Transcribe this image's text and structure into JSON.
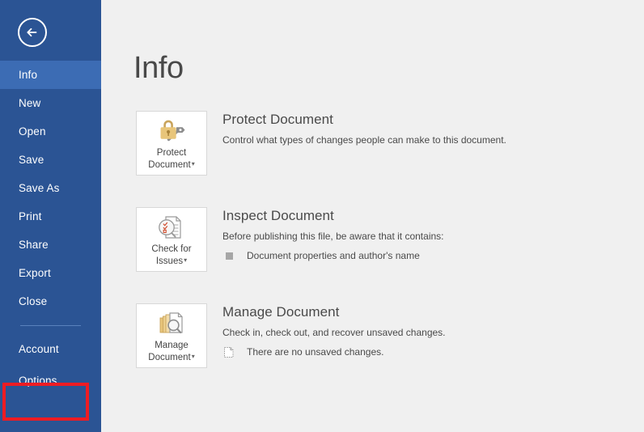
{
  "colors": {
    "sidebar_bg": "#2b5494",
    "sidebar_selected": "#3c6cb4",
    "main_bg": "#f0f0f0",
    "highlight_red": "#ee1c23",
    "text_gray": "#4a4a4a",
    "lock_gold": "#e8c57a",
    "key_gray": "#8c8c8c"
  },
  "sidebar": {
    "back_button": {
      "icon": "back-arrow-icon",
      "label": "Back"
    },
    "items": [
      {
        "label": "Info",
        "selected": true
      },
      {
        "label": "New",
        "selected": false
      },
      {
        "label": "Open",
        "selected": false
      },
      {
        "label": "Save",
        "selected": false
      },
      {
        "label": "Save As",
        "selected": false
      },
      {
        "label": "Print",
        "selected": false
      },
      {
        "label": "Share",
        "selected": false
      },
      {
        "label": "Export",
        "selected": false
      },
      {
        "label": "Close",
        "selected": false
      }
    ],
    "footer_items": [
      {
        "label": "Account",
        "selected": false
      },
      {
        "label": "Options",
        "selected": false,
        "highlighted": true
      }
    ]
  },
  "main": {
    "title": "Info",
    "sections": [
      {
        "button_label_line1": "Protect",
        "button_label_line2": "Document",
        "button_caret": "▾",
        "button_icon": "lock-and-key-icon",
        "heading": "Protect Document",
        "description": "Control what types of changes people can make to this document.",
        "bullets": []
      },
      {
        "button_label_line1": "Check for",
        "button_label_line2": "Issues",
        "button_caret": "▾",
        "button_icon": "document-inspect-icon",
        "heading": "Inspect Document",
        "description": "Before publishing this file, be aware that it contains:",
        "bullets": [
          {
            "icon": "gray-square-icon",
            "text": "Document properties and author's name"
          }
        ]
      },
      {
        "button_label_line1": "Manage",
        "button_label_line2": "Document",
        "button_caret": "▾",
        "button_icon": "manage-documents-icon",
        "heading": "Manage Document",
        "description": "Check in, check out, and recover unsaved changes.",
        "bullets": [
          {
            "icon": "dotted-document-icon",
            "text": "There are no unsaved changes."
          }
        ]
      }
    ]
  }
}
